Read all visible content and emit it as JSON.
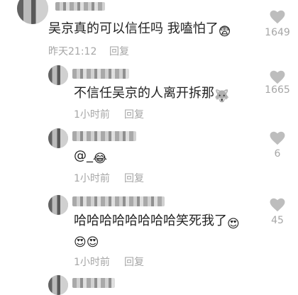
{
  "comments": [
    {
      "text": "吴京真的可以信任吗 我嗑怕了",
      "emoji": "😨",
      "time": "昨天21:12",
      "reply": "回复",
      "likes": "1649"
    },
    {
      "text": "不信任吴京的人离开拆那",
      "emoji": "🐺",
      "time": "1小时前",
      "reply": "回复",
      "likes": "1665"
    },
    {
      "text": "@_",
      "emoji": "😂",
      "time": "1小时前",
      "reply": "回复",
      "likes": "6"
    },
    {
      "text": "哈哈哈哈哈哈哈哈笑死我了",
      "emoji": "😍",
      "emoji_line2": "😍😍",
      "time": "1小时前",
      "reply": "回复",
      "likes": "45"
    }
  ],
  "colors": {
    "heart": "#bdbdbd",
    "meta": "#a6a6a6",
    "text": "#222222"
  }
}
